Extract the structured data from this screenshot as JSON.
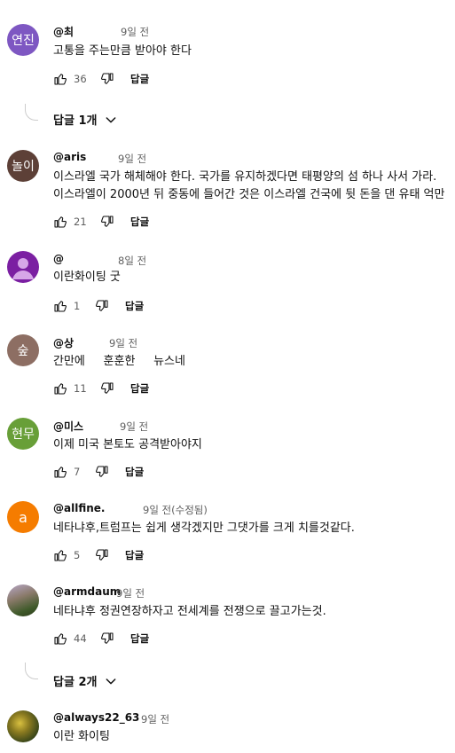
{
  "reply_label": "답글",
  "comments": [
    {
      "avatar_text": "연진",
      "avatar_color": "#7e57c2",
      "author": "@최",
      "time": "9일 전",
      "lines": [
        "고통을 주는만큼 받아야 한다"
      ],
      "likes": "36"
    },
    {
      "avatar_text": "놀이",
      "avatar_color": "#5d4037",
      "author": "@aris",
      "time": "9일 전",
      "lines": [
        "이스라엘 국가 해체해야 한다. 국가를 유지하겠다면 태평양의 섬 하나 사서 가라.",
        "이스라엘이 2000년 뒤 중동에 들어간 것은 이스라엘 건국에 뒷 돈을 댄 유태 억만"
      ],
      "likes": "21"
    },
    {
      "avatar_text": "",
      "avatar_color": "#7b1fa2",
      "author": "@",
      "time": "8일 전",
      "lines": [
        "이란화이팅 굿"
      ],
      "likes": "1"
    },
    {
      "avatar_text": "숲",
      "avatar_color": "#8d6e63",
      "author": "@상",
      "time": "9일 전",
      "lines": [
        "간만에     훈훈한     뉴스네"
      ],
      "likes": "11"
    },
    {
      "avatar_text": "현무",
      "avatar_color": "#689f38",
      "author": "@미스",
      "time": "9일 전",
      "lines": [
        "이제 미국 본토도 공격받아야지"
      ],
      "likes": "7"
    },
    {
      "avatar_text": "a",
      "avatar_color": "#f57c00",
      "author": "@allfine.",
      "time": "9일 전(수정됨)",
      "lines": [
        "네타냐후,트럼프는 쉽게 생각겠지만 그댓가를 크게 치를것같다."
      ],
      "likes": "5"
    },
    {
      "avatar_text": "",
      "avatar_color": "#6d7a4a",
      "author": "@armdaum",
      "time": "9일 전",
      "lines": [
        "네타냐후 정권연장하자고 전세계를 전쟁으로 끌고가는것."
      ],
      "likes": "44"
    },
    {
      "avatar_text": "",
      "avatar_color": "#4a5a22",
      "author": "@always22_63",
      "time": "9일 전",
      "lines": [
        "이란 화이팅"
      ],
      "likes": ""
    }
  ],
  "more_replies": [
    {
      "label": "답글 1개"
    },
    {
      "label": "답글 2개"
    }
  ]
}
